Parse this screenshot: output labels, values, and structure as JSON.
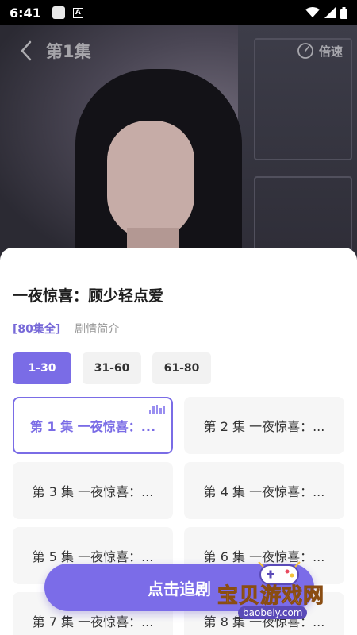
{
  "status_bar": {
    "time": "6:41",
    "a_badge": "A"
  },
  "player": {
    "episode_title": "第1集",
    "speed_label": "倍速"
  },
  "drama": {
    "title": "一夜惊喜：顾少轻点爱",
    "episode_count": "[80集全]",
    "synopsis_label": "剧情简介"
  },
  "ranges": [
    {
      "label": "1-30",
      "active": true
    },
    {
      "label": "31-60",
      "active": false
    },
    {
      "label": "61-80",
      "active": false
    }
  ],
  "episodes": [
    {
      "label": "第 1 集 一夜惊喜：...",
      "active": true
    },
    {
      "label": "第 2 集 一夜惊喜：..."
    },
    {
      "label": "第 3 集 一夜惊喜：..."
    },
    {
      "label": "第 4 集 一夜惊喜：..."
    },
    {
      "label": "第 5 集 一夜惊喜：..."
    },
    {
      "label": "第 6 集 一夜惊喜：..."
    },
    {
      "label": "第 7 集 一夜惊喜：..."
    },
    {
      "label": "第 8 集 一夜惊喜：..."
    }
  ],
  "follow_button": {
    "label": "点击追剧"
  },
  "watermark": {
    "text": "宝贝游戏网",
    "url": "baobeiy.com"
  },
  "colors": {
    "accent": "#7a6ce6",
    "accent_text": "#7769d8"
  }
}
